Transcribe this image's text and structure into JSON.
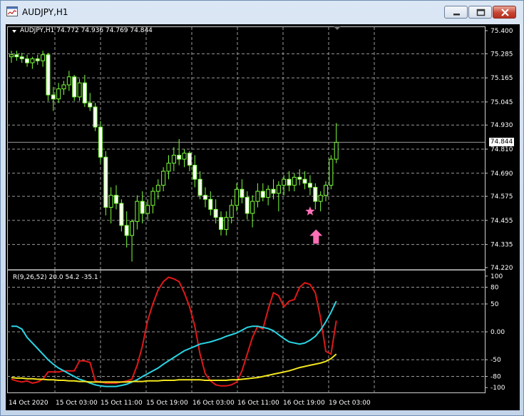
{
  "window": {
    "title": "AUDJPY,H1"
  },
  "main_header": {
    "symbol": "AUDJPY,H1",
    "open": "74.772",
    "high": "74.936",
    "low": "74.769",
    "close": "74.844"
  },
  "indicator_header": {
    "label": "R(9,26,52)",
    "v1": "20.0",
    "v2": "54.2",
    "v3": "-35.1"
  },
  "current_price": "74.844",
  "colors": {
    "bg": "#000000",
    "grid": "#9a9a9a",
    "bull": "#7cff3c",
    "bear": "#ffffff",
    "marker": "#ff6fb8",
    "fast": "#e01818",
    "mid": "#2ad6e6",
    "slow": "#f2e61e"
  },
  "icons": {
    "marker_star": "star-icon",
    "marker_arrow": "up-arrow-icon"
  },
  "chart_data": [
    {
      "type": "candlestick",
      "x_labels": [
        "14 Oct 2020",
        "15 Oct 03:00",
        "15 Oct 11:00",
        "15 Oct 19:00",
        "16 Oct 03:00",
        "16 Oct 11:00",
        "16 Oct 19:00",
        "19 Oct 03:00"
      ],
      "y_ticks": [
        "75.400",
        "75.285",
        "75.165",
        "75.045",
        "74.930",
        "74.810",
        "74.690",
        "74.575",
        "74.455",
        "74.335",
        "74.220"
      ],
      "ylim": [
        74.22,
        75.4
      ],
      "last_close": 74.844,
      "ohlc": [
        [
          75.27,
          75.3,
          75.24,
          75.28
        ],
        [
          75.28,
          75.3,
          75.25,
          75.27
        ],
        [
          75.27,
          75.29,
          75.24,
          75.26
        ],
        [
          75.26,
          75.28,
          75.22,
          75.24
        ],
        [
          75.24,
          75.27,
          75.21,
          75.26
        ],
        [
          75.26,
          75.28,
          75.23,
          75.25
        ],
        [
          75.25,
          75.3,
          75.22,
          75.28
        ],
        [
          75.28,
          75.29,
          75.05,
          75.08
        ],
        [
          75.08,
          75.12,
          75.0,
          75.06
        ],
        [
          75.06,
          75.14,
          75.04,
          75.11
        ],
        [
          75.11,
          75.15,
          75.08,
          75.13
        ],
        [
          75.13,
          75.2,
          75.1,
          75.17
        ],
        [
          75.17,
          75.18,
          75.05,
          75.07
        ],
        [
          75.07,
          75.16,
          75.05,
          75.14
        ],
        [
          75.14,
          75.18,
          75.02,
          75.04
        ],
        [
          75.04,
          75.09,
          75.0,
          75.02
        ],
        [
          75.02,
          75.04,
          74.9,
          74.92
        ],
        [
          74.92,
          74.95,
          74.74,
          74.77
        ],
        [
          74.77,
          74.8,
          74.48,
          74.52
        ],
        [
          74.52,
          74.62,
          74.44,
          74.58
        ],
        [
          74.58,
          74.63,
          74.51,
          74.54
        ],
        [
          74.54,
          74.56,
          74.4,
          74.43
        ],
        [
          74.43,
          74.5,
          74.32,
          74.38
        ],
        [
          74.38,
          74.46,
          74.25,
          74.45
        ],
        [
          74.45,
          74.58,
          74.41,
          74.55
        ],
        [
          74.55,
          74.6,
          74.44,
          74.49
        ],
        [
          74.49,
          74.56,
          74.46,
          74.53
        ],
        [
          74.53,
          74.62,
          74.49,
          74.6
        ],
        [
          74.6,
          74.66,
          74.56,
          74.63
        ],
        [
          74.63,
          74.72,
          74.6,
          74.7
        ],
        [
          74.7,
          74.78,
          74.66,
          74.74
        ],
        [
          74.74,
          74.82,
          74.7,
          74.78
        ],
        [
          74.78,
          74.86,
          74.73,
          74.76
        ],
        [
          74.76,
          74.81,
          74.72,
          74.79
        ],
        [
          74.79,
          74.8,
          74.7,
          74.73
        ],
        [
          74.73,
          74.78,
          74.62,
          74.66
        ],
        [
          74.66,
          74.7,
          74.56,
          74.58
        ],
        [
          74.58,
          74.62,
          74.52,
          74.56
        ],
        [
          74.56,
          74.6,
          74.48,
          74.51
        ],
        [
          74.51,
          74.56,
          74.44,
          74.47
        ],
        [
          74.47,
          74.5,
          74.38,
          74.41
        ],
        [
          74.41,
          74.5,
          74.38,
          74.47
        ],
        [
          74.47,
          74.56,
          74.44,
          74.53
        ],
        [
          74.53,
          74.64,
          74.5,
          74.61
        ],
        [
          74.61,
          74.66,
          74.54,
          74.57
        ],
        [
          74.57,
          74.6,
          74.46,
          74.49
        ],
        [
          74.49,
          74.58,
          74.42,
          74.55
        ],
        [
          74.55,
          74.64,
          74.52,
          74.6
        ],
        [
          74.6,
          74.64,
          74.55,
          74.57
        ],
        [
          74.57,
          74.63,
          74.53,
          74.61
        ],
        [
          74.61,
          74.66,
          74.56,
          74.59
        ],
        [
          74.59,
          74.65,
          74.5,
          74.63
        ],
        [
          74.63,
          74.68,
          74.58,
          74.66
        ],
        [
          74.66,
          74.7,
          74.6,
          74.63
        ],
        [
          74.63,
          74.69,
          74.6,
          74.67
        ],
        [
          74.67,
          74.71,
          74.63,
          74.66
        ],
        [
          74.66,
          74.7,
          74.61,
          74.64
        ],
        [
          74.64,
          74.68,
          74.58,
          74.62
        ],
        [
          74.62,
          74.64,
          74.51,
          74.55
        ],
        [
          74.55,
          74.6,
          74.5,
          74.58
        ],
        [
          74.58,
          74.65,
          74.55,
          74.63
        ],
        [
          74.63,
          74.78,
          74.61,
          74.76
        ],
        [
          74.76,
          74.94,
          74.74,
          74.844
        ]
      ]
    },
    {
      "type": "line",
      "ylim": [
        -110,
        105
      ],
      "y_ticks": [
        "100",
        "80",
        "50",
        "0.00",
        "-50",
        "-80",
        "-100"
      ],
      "series": [
        {
          "values": [
            -85,
            -88,
            -90,
            -88,
            -92,
            -90,
            -85,
            -72,
            -72,
            -72,
            -70,
            -70,
            -70,
            -52,
            -52,
            -55,
            -88,
            -90,
            -92,
            -92,
            -92,
            -90,
            -88,
            -85,
            -60,
            -25,
            20,
            50,
            75,
            90,
            98,
            95,
            90,
            70,
            45,
            10,
            -40,
            -75,
            -88,
            -95,
            -97,
            -97,
            -95,
            -90,
            -70,
            -40,
            -10,
            10,
            5,
            40,
            70,
            65,
            45,
            55,
            58,
            80,
            88,
            85,
            70,
            25,
            -35,
            -40,
            20
          ]
        },
        {
          "values": [
            10,
            10,
            5,
            -10,
            -20,
            -30,
            -40,
            -50,
            -58,
            -65,
            -70,
            -75,
            -80,
            -85,
            -88,
            -92,
            -95,
            -97,
            -98,
            -98,
            -98,
            -96,
            -94,
            -90,
            -86,
            -80,
            -75,
            -70,
            -65,
            -58,
            -52,
            -46,
            -40,
            -34,
            -30,
            -26,
            -22,
            -20,
            -18,
            -15,
            -12,
            -8,
            -5,
            -2,
            3,
            8,
            10,
            10,
            8,
            6,
            2,
            -5,
            -12,
            -18,
            -20,
            -22,
            -20,
            -15,
            -8,
            3,
            18,
            35,
            55
          ]
        },
        {
          "values": [
            -82,
            -83,
            -83,
            -84,
            -84,
            -85,
            -85,
            -86,
            -86,
            -87,
            -87,
            -88,
            -88,
            -89,
            -89,
            -90,
            -90,
            -90,
            -90,
            -90,
            -90,
            -90,
            -90,
            -89,
            -89,
            -89,
            -88,
            -88,
            -88,
            -87,
            -87,
            -87,
            -86,
            -86,
            -86,
            -86,
            -86,
            -87,
            -87,
            -87,
            -87,
            -87,
            -86,
            -86,
            -85,
            -84,
            -83,
            -82,
            -80,
            -78,
            -76,
            -74,
            -72,
            -70,
            -67,
            -64,
            -62,
            -60,
            -58,
            -56,
            -53,
            -48,
            -40
          ]
        }
      ]
    }
  ]
}
